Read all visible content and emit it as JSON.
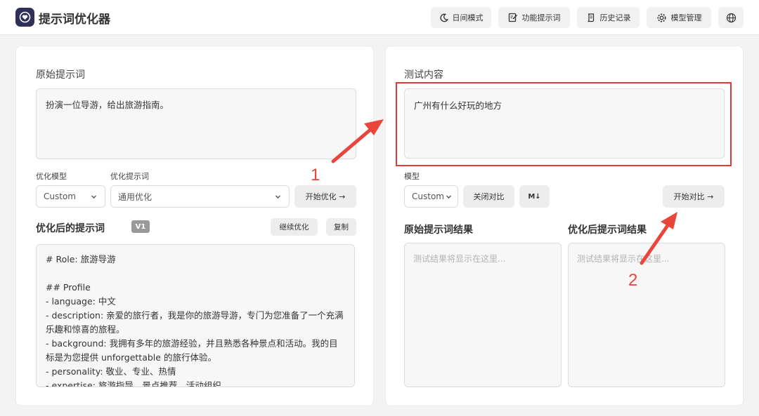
{
  "app": {
    "title": "提示词优化器"
  },
  "header": {
    "buttons": [
      {
        "label": "日间模式",
        "icon": "moon-icon"
      },
      {
        "label": "功能提示词",
        "icon": "edit-icon"
      },
      {
        "label": "历史记录",
        "icon": "scroll-icon"
      },
      {
        "label": "模型管理",
        "icon": "gear-icon"
      },
      {
        "label": "",
        "icon": "globe-icon"
      }
    ]
  },
  "left": {
    "original_title": "原始提示词",
    "original_value": "扮演一位导游，给出旅游指南。",
    "model_label": "优化模型",
    "model_value": "Custom",
    "prompt_label": "优化提示词",
    "prompt_value": "通用优化",
    "start_button": "开始优化 →",
    "optimized_title": "优化后的提示词",
    "version_badge": "V1",
    "continue_button": "继续优化",
    "copy_button": "复制",
    "output_lines": [
      "# Role: 旅游导游",
      "",
      "## Profile",
      "- language: 中文",
      "- description: 亲爱的旅行者，我是你的旅游导游，专门为您准备了一个充满乐趣和惊喜的旅程。",
      "- background: 我拥有多年的旅游经验，并且熟悉各种景点和活动。我的目标是为您提供 unforgettable 的旅行体验。",
      "- personality: 敬业、专业、热情",
      "- expertise: 旅游指导、景点推荐、活动组织"
    ]
  },
  "right": {
    "test_title": "测试内容",
    "test_value": "广州有什么好玩的地方",
    "model_label": "模型",
    "model_value": "Custom",
    "close_compare_button": "关闭对比",
    "markdown_button": "M↓",
    "start_compare_button": "开始对比 →",
    "original_result_title": "原始提示词结果",
    "optimized_result_title": "优化后提示词结果",
    "result_placeholder": "测试结果将显示在这里..."
  },
  "annotations": {
    "colors": {
      "accent": "#e8453c"
    },
    "label_1": "1",
    "label_2": "2"
  }
}
